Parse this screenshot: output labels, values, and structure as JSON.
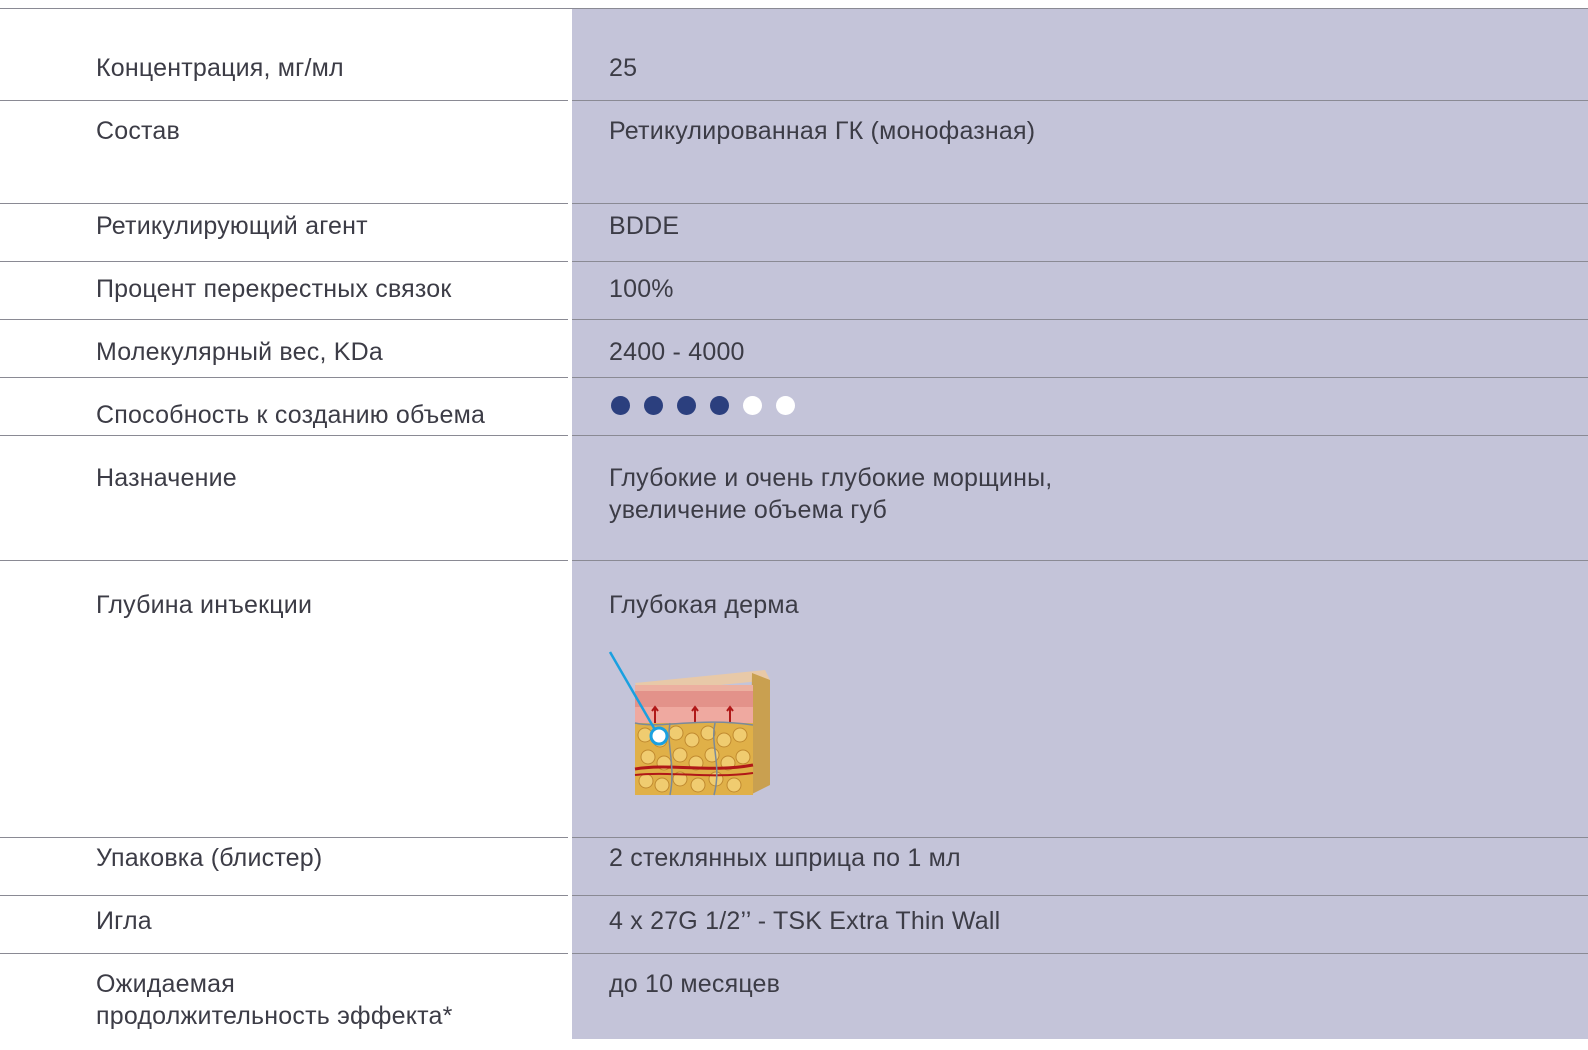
{
  "rows": [
    {
      "label": "Концентрация, мг/мл",
      "value": "25"
    },
    {
      "label": "Состав",
      "value": "Ретикулированная ГК (монофазная)"
    },
    {
      "label": "Ретикулирующий агент",
      "value": "BDDE"
    },
    {
      "label": "Процент перекрестных связок",
      "value": "100%"
    },
    {
      "label": "Молекулярный вес, KDa",
      "value": "2400 - 4000"
    },
    {
      "label": "Способность к созданию объема",
      "volume_rating": 4,
      "volume_max": 5
    },
    {
      "label": "Назначение",
      "value": "Глубокие и очень глубокие морщины,\nувеличение объема губ"
    },
    {
      "label": "Глубина инъекции",
      "value": "Глубокая дерма",
      "icon": "skin-cross-section-icon"
    },
    {
      "label": "Упаковка (блистер)",
      "value": "2 стеклянных шприца по 1 мл"
    },
    {
      "label": "Игла",
      "value": "4 x 27G 1/2’’ - TSK Extra Thin Wall"
    },
    {
      "label": "Ожидаемая\nпродолжительность эффекта*",
      "value": "до 10 месяцев"
    }
  ],
  "colors": {
    "value_panel": "#c4c4d9",
    "dot_filled": "#2b3f7e",
    "dot_empty": "#ffffff",
    "text": "#3c3c46",
    "separator": "#8a8a94"
  }
}
